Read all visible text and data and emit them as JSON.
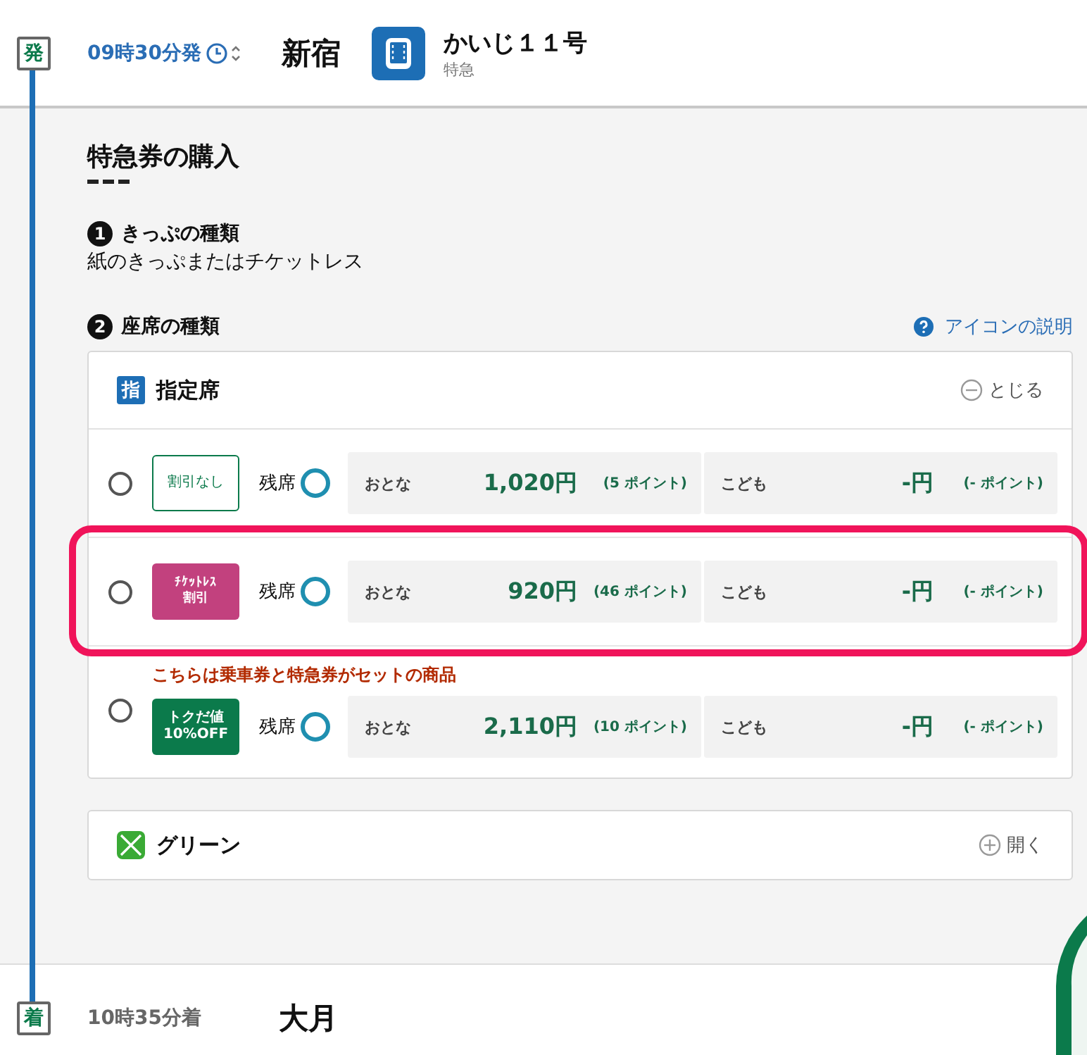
{
  "departure": {
    "mark": "発",
    "time": "09時30分発",
    "station": "新宿",
    "train_name": "かいじ１１号",
    "train_type": "特急"
  },
  "purchase": {
    "title": "特急券の購入",
    "step1": {
      "number": "1",
      "label": "きっぷの種類",
      "value": "紙のきっぷまたはチケットレス"
    },
    "step2": {
      "number": "2",
      "label": "座席の種類",
      "help_link": "アイコンの説明"
    }
  },
  "sections": [
    {
      "kind": "reserved",
      "icon_char": "指",
      "title": "指定席",
      "toggle": "とじる",
      "expanded": true,
      "rows": [
        {
          "kind": "plain",
          "badge_lines": [
            "割引なし"
          ],
          "selected": false,
          "highlighted": false,
          "seat_label": "残席",
          "adult_label": "おとな",
          "adult_price": "1,020円",
          "adult_points": "(5 ポイント)",
          "child_label": "こども",
          "child_price": "-円",
          "child_points": "(- ポイント)"
        },
        {
          "kind": "ticketless",
          "badge_lines": [
            "ﾁｹｯﾄﾚｽ",
            "割引"
          ],
          "selected": false,
          "highlighted": true,
          "seat_label": "残席",
          "adult_label": "おとな",
          "adult_price": "920円",
          "adult_points": "(46 ポイント)",
          "child_label": "こども",
          "child_price": "-円",
          "child_points": "(- ポイント)"
        },
        {
          "kind": "deal",
          "badge_lines": [
            "トクだ値",
            "10%OFF"
          ],
          "selected": false,
          "highlighted": false,
          "note": "こちらは乗車券と特急券がセットの商品",
          "seat_label": "残席",
          "adult_label": "おとな",
          "adult_price": "2,110円",
          "adult_points": "(10 ポイント)",
          "child_label": "こども",
          "child_price": "-円",
          "child_points": "(- ポイント)"
        }
      ]
    },
    {
      "kind": "green",
      "title": "グリーン",
      "toggle": "開く",
      "expanded": false
    }
  ],
  "arrival": {
    "mark": "着",
    "time": "10時35分着",
    "station": "大月"
  }
}
